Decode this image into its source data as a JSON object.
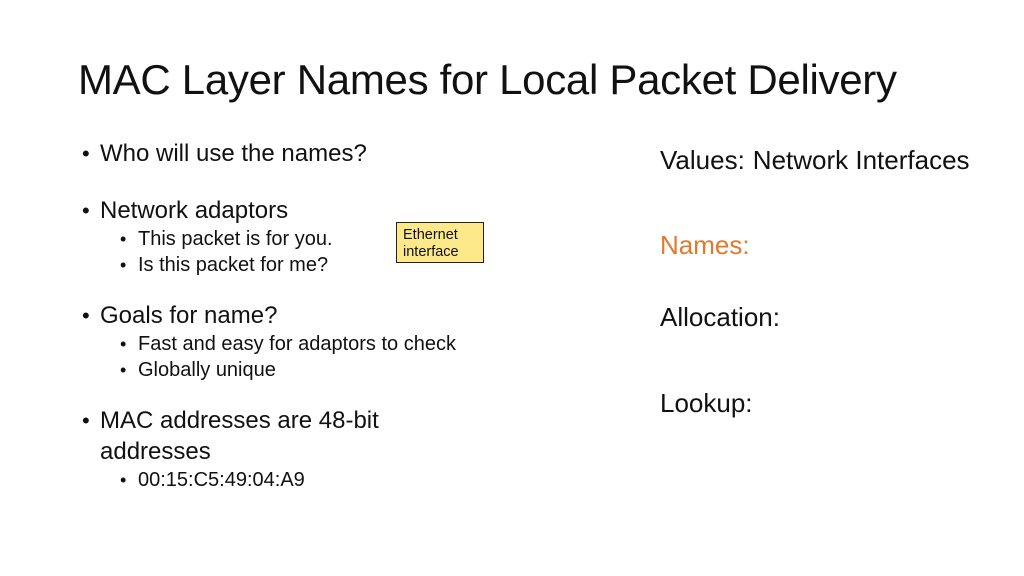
{
  "slide": {
    "title": "MAC Layer Names for Local Packet Delivery"
  },
  "bullets": {
    "who": "Who will use the names?",
    "adaptors": {
      "label": "Network adaptors",
      "sub": [
        "This packet is for you.",
        "Is this packet for me?"
      ]
    },
    "goals": {
      "label": "Goals for name?",
      "sub": [
        "Fast and easy for adaptors to check",
        "Globally unique"
      ]
    },
    "mac": {
      "label": "MAC addresses are 48-bit addresses",
      "sub": [
        "00:15:C5:49:04:A9"
      ]
    }
  },
  "callout": {
    "line1": "Ethernet",
    "line2": "interface"
  },
  "right_panel": {
    "values_label": "Values:",
    "values_text": "Network Interfaces",
    "names_label": "Names:",
    "allocation_label": "Allocation:",
    "lookup_label": "Lookup:"
  },
  "colors": {
    "names_accent": "#e07a2e",
    "callout_fill": "#fde98a"
  }
}
